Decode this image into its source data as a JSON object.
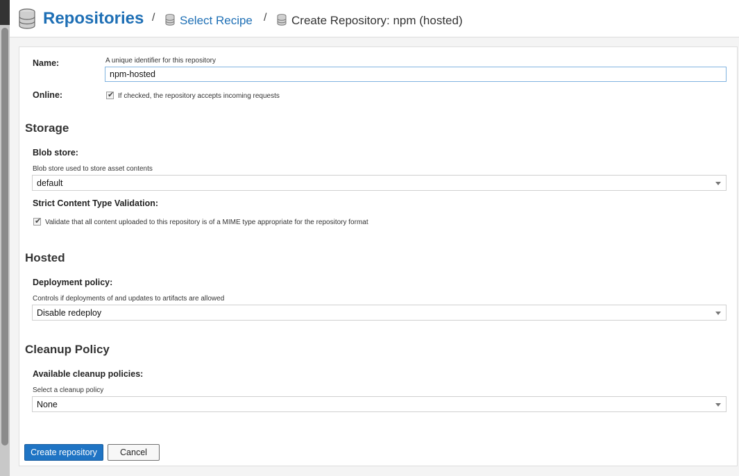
{
  "breadcrumb": {
    "root": "Repositories",
    "separator": "/",
    "recipe": "Select Recipe",
    "current": "Create Repository: npm (hosted)"
  },
  "form": {
    "name": {
      "label": "Name:",
      "help": "A unique identifier for this repository",
      "value": "npm-hosted"
    },
    "online": {
      "label": "Online:",
      "help": "If checked, the repository accepts incoming requests",
      "checked": true
    },
    "storage": {
      "title": "Storage",
      "blob_store": {
        "label": "Blob store:",
        "help": "Blob store used to store asset contents",
        "value": "default"
      },
      "strict": {
        "label": "Strict Content Type Validation:",
        "help": "Validate that all content uploaded to this repository is of a MIME type appropriate for the repository format",
        "checked": true
      }
    },
    "hosted": {
      "title": "Hosted",
      "deployment": {
        "label": "Deployment policy:",
        "help": "Controls if deployments of and updates to artifacts are allowed",
        "value": "Disable redeploy"
      }
    },
    "cleanup": {
      "title": "Cleanup Policy",
      "policies": {
        "label": "Available cleanup policies:",
        "help": "Select a cleanup policy",
        "value": "None"
      }
    }
  },
  "actions": {
    "create": "Create repository",
    "cancel": "Cancel"
  },
  "colors": {
    "link": "#1e6fb5",
    "primary": "#1f74c4"
  }
}
